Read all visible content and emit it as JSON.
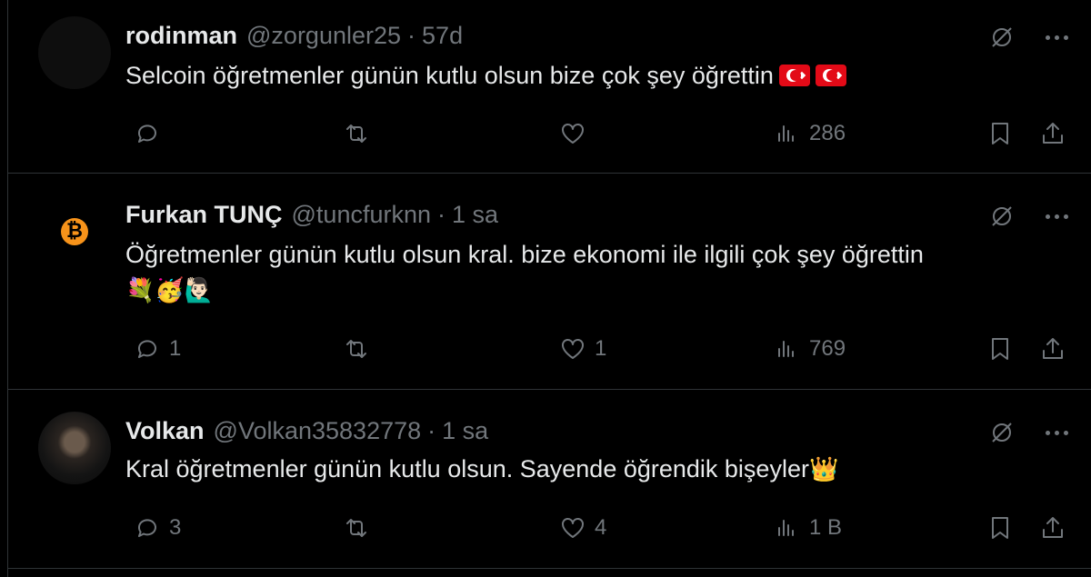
{
  "tweets": [
    {
      "name": "rodinman",
      "handle": "@zorgunler25",
      "separator": "·",
      "time": "57d",
      "text": "Selcoin öğretmenler günün kutlu olsun bize çok şey öğrettin",
      "text_line2": "",
      "emoji": "🇹🇷🇹🇷",
      "replies": "",
      "retweets": "",
      "likes": "",
      "views": "286"
    },
    {
      "name": "Furkan TUNÇ",
      "handle": "@tuncfurknn",
      "separator": "·",
      "time": "1 sa",
      "text": "Öğretmenler günün kutlu olsun kral. bize ekonomi ile ilgili çok şey öğrettin",
      "text_line2": "💐🥳🙋🏻‍♂️",
      "avatar_icon": "bitcoin-icon",
      "avatar_symbol": "₿",
      "replies": "1",
      "retweets": "",
      "likes": "1",
      "views": "769"
    },
    {
      "name": "Volkan",
      "handle": "@Volkan35832778",
      "separator": "·",
      "time": "1 sa",
      "text": "Kral öğretmenler günün kutlu olsun. Sayende öğrendik bişeyler",
      "emoji": "👑",
      "replies": "3",
      "retweets": "",
      "likes": "4",
      "views": "1 B"
    }
  ],
  "colors": {
    "background": "#000000",
    "text_primary": "#e7e9ea",
    "text_secondary": "#71767b",
    "divider": "#2f3336",
    "bitcoin_orange": "#f7931a"
  }
}
